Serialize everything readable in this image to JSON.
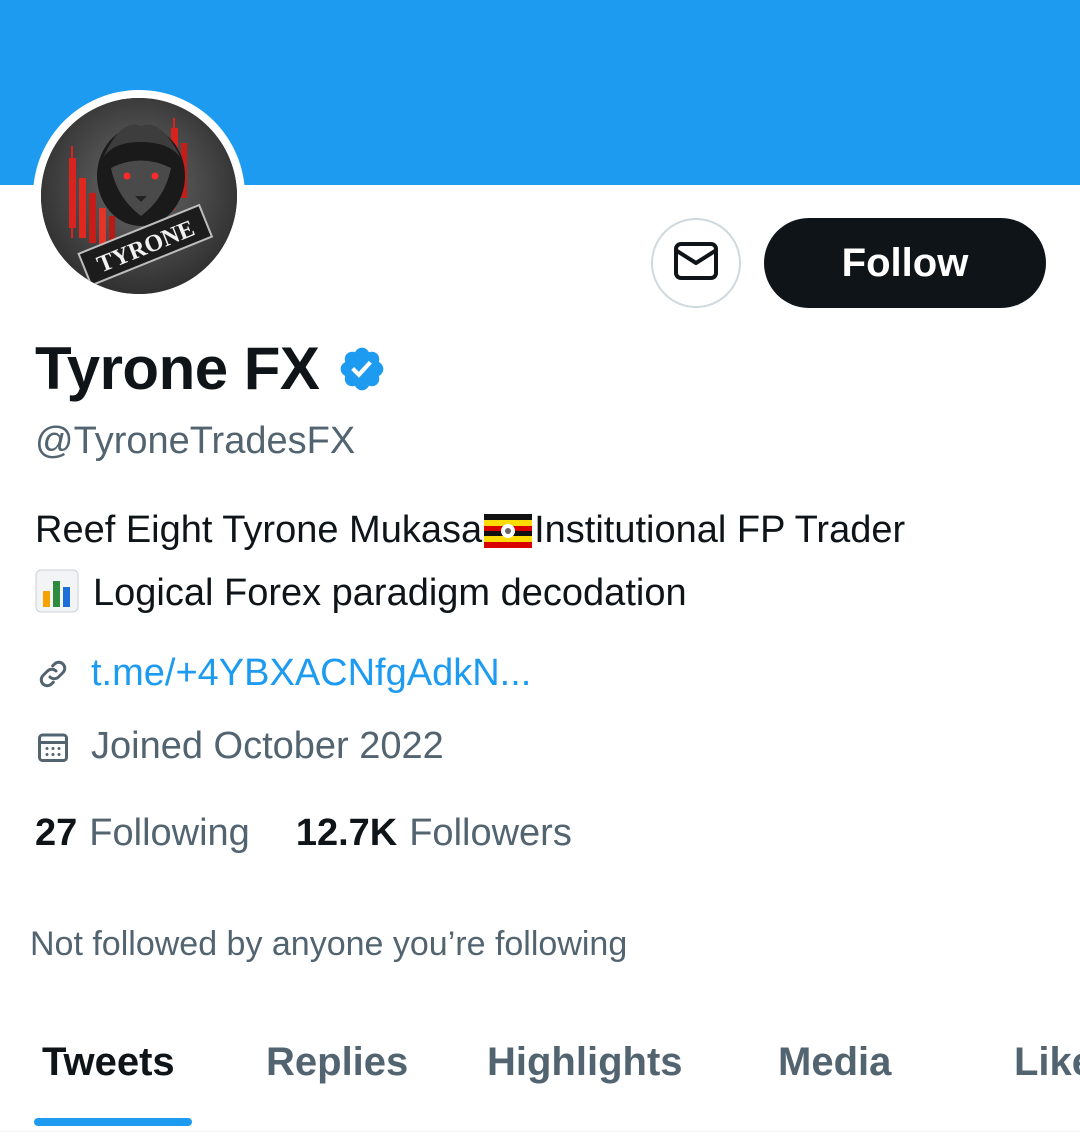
{
  "colors": {
    "banner": "#1d9bf0",
    "accent": "#1d9bf0",
    "primary_text": "#0f1419",
    "secondary_text": "#536471",
    "follow_button": "#0f1419"
  },
  "avatar": {
    "logo_text": "TYRONE",
    "icon": "lion-trading-logo"
  },
  "actions": {
    "message_icon": "envelope-icon",
    "follow_label": "Follow"
  },
  "profile": {
    "display_name": "Tyrone FX",
    "verified_icon": "verified-badge-icon",
    "handle": "@TyroneTradesFX",
    "bio_line1_before_flag": "Reef Eight Tyrone Mukasa",
    "flag_icon": "uganda-flag-icon",
    "bio_line1_after_flag": "Institutional FP Trader",
    "chart_icon": "bar-chart-icon",
    "bio_line2": "Logical Forex paradigm decodation",
    "link_icon": "link-icon",
    "link_text": "t.me/+4YBXACNfgAdkN...",
    "calendar_icon": "calendar-icon",
    "joined_text": "Joined October 2022"
  },
  "stats": {
    "following_count": "27",
    "following_label": "Following",
    "followers_count": "12.7K",
    "followers_label": "Followers"
  },
  "not_followed_text": "Not followed by anyone you’re following",
  "tabs": [
    {
      "label": "Tweets",
      "active": true
    },
    {
      "label": "Replies",
      "active": false
    },
    {
      "label": "Highlights",
      "active": false
    },
    {
      "label": "Media",
      "active": false
    },
    {
      "label": "Likes",
      "active": false
    }
  ]
}
